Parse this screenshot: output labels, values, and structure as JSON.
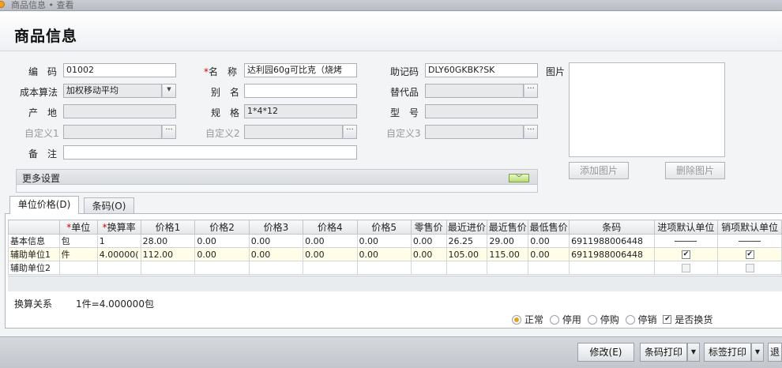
{
  "breadcrumb": "商品信息 • 查看",
  "page_title": "商品信息",
  "form": {
    "code_label": "编　码",
    "code_value": "01002",
    "name_label": "名　称",
    "name_value": "达利园60g可比克（烧烤",
    "mnemonic_label": "助记码",
    "mnemonic_value": "DLY60GKBK?SK",
    "image_label": "图片",
    "cost_label": "成本算法",
    "cost_value": "加权移动平均",
    "alias_label": "别　名",
    "alias_value": "",
    "substitute_label": "替代品",
    "substitute_value": "",
    "origin_label": "产　地",
    "origin_value": "",
    "spec_label": "规　格",
    "spec_value": "1*4*12",
    "model_label": "型　号",
    "model_value": "",
    "custom1_label": "自定义1",
    "custom2_label": "自定义2",
    "custom3_label": "自定义3",
    "remark_label": "备　注",
    "remark_value": ""
  },
  "buttons": {
    "add_image": "添加图片",
    "delete_image": "删除图片",
    "ellipsis": "···",
    "dropdown": "▼"
  },
  "more_settings": "更多设置",
  "tabs": [
    "单位价格(D)",
    "条码(O)"
  ],
  "grid": {
    "headers": [
      "",
      "单位",
      "换算率",
      "价格1",
      "价格2",
      "价格3",
      "价格4",
      "价格5",
      "零售价",
      "最近进价",
      "最近售价",
      "最低售价",
      "条码",
      "进项默认单位",
      "销项默认单位"
    ],
    "rows": [
      {
        "name": "基本信息",
        "unit": "包",
        "rate": "1",
        "p1": "28.00",
        "p2": "0.00",
        "p3": "0.00",
        "p4": "0.00",
        "p5": "0.00",
        "retail": "0.00",
        "last_in": "26.25",
        "last_out": "29.00",
        "min": "0.00",
        "barcode": "6911988006448",
        "in_default": "dash",
        "out_default": "dash"
      },
      {
        "name": "辅助单位1",
        "unit": "件",
        "rate": "4.00000(",
        "p1": "112.00",
        "p2": "0.00",
        "p3": "0.00",
        "p4": "0.00",
        "p5": "0.00",
        "retail": "0.00",
        "last_in": "105.00",
        "last_out": "115.00",
        "min": "0.00",
        "barcode": "6911988006448",
        "in_default": "checked",
        "out_default": "checked"
      },
      {
        "name": "辅助单位2",
        "unit": "",
        "rate": "",
        "p1": "",
        "p2": "",
        "p3": "",
        "p4": "",
        "p5": "",
        "retail": "",
        "last_in": "",
        "last_out": "",
        "min": "",
        "barcode": "",
        "in_default": "unchecked",
        "out_default": "unchecked"
      }
    ]
  },
  "conversion_label": "换算关系",
  "conversion_value": "1件=4.000000包",
  "status_options": [
    "正常",
    "停用",
    "停购",
    "停销"
  ],
  "status_selected": "正常",
  "exchange_label": "是否换货",
  "exchange_checked": true,
  "footer_buttons": [
    "修改(E)",
    "条码打印",
    "标签打印",
    "退"
  ],
  "colors": {
    "accent": "#e8a020",
    "title_bg": "#ffffff",
    "footer_bg": "#c8ccd2"
  }
}
